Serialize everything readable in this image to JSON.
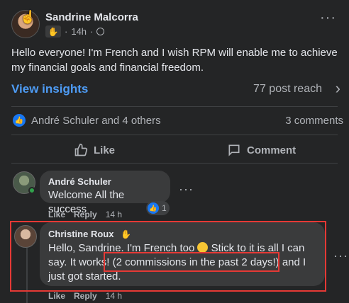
{
  "post": {
    "author": "Sandrine Malcorra",
    "time": "14h",
    "dot": "·",
    "text": "Hello everyone! I'm French and I wish RPM will enable me to achieve my financial goals and financial freedom.",
    "insights_label": "View insights",
    "reach": "77 post reach",
    "reactors": "André Schuler and 4 others",
    "comments_count": "3 comments",
    "like_label": "Like",
    "comment_label": "Comment"
  },
  "comments": [
    {
      "author": "André Schuler",
      "text": "Welcome All the success",
      "like": "Like",
      "reply": "Reply",
      "time": "14 h",
      "reaction_count": "1"
    },
    {
      "author": "Christine Roux",
      "text_part1": "Hello, Sandrine. I'm French too ",
      "text_part2": " Stick to it is all I can say. It works! ",
      "text_highlight": "(2 commissions in the past 2 days!)",
      "text_part3": " and I just got started.",
      "like": "Like",
      "reply": "Reply",
      "time": "14 h"
    }
  ],
  "icons": {
    "more": "more-dots-icon",
    "globe": "globe-icon",
    "like": "thumbs-up-icon",
    "comment": "comment-bubble-icon",
    "chevron": "chevron-right-icon"
  },
  "colors": {
    "background": "#242526",
    "accent": "#4e9cf5",
    "highlight": "#e53935"
  }
}
